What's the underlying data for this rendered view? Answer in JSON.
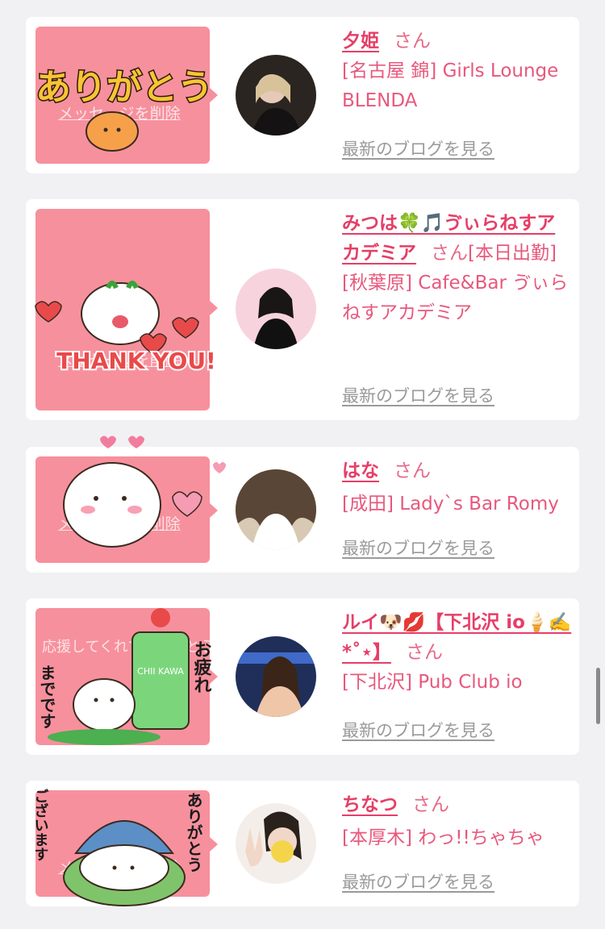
{
  "entries": [
    {
      "name": "夕姫",
      "honorific": "さん",
      "shop": "[名古屋 錦] Girls Lounge BLENDA",
      "blog_link": "最新のブログを見る",
      "sticker_ghost": "メッセージを削除",
      "sticker_text": "ありがとう",
      "sticker_icon": "chick-thanks-sticker",
      "avatar_icon": "avatar-dark-hair"
    },
    {
      "name": "みつは🍀🎵ゔぃらねすアカデミア",
      "honorific": "さん",
      "shop_extra": "[本日出勤]",
      "shop": "[秋葉原] Cafe&Bar ゔぃらねすアカデミア",
      "blog_link": "最新のブログを見る",
      "sticker_ghost": "メッセージを削除",
      "sticker_text": "THANK YOU!",
      "sticker_icon": "bear-thank-you-sticker",
      "avatar_icon": "avatar-black-dress"
    },
    {
      "name": "はな",
      "honorific": "さん",
      "shop": "[成田] Lady`s Bar Romy",
      "blog_link": "最新のブログを見る",
      "sticker_ghost": "メッセージを削除",
      "sticker_icon": "bear-hearts-sticker",
      "avatar_icon": "avatar-brown-hair"
    },
    {
      "name": "ルイ🐶💋【下北沢 io🍦✍️*˚⋆】",
      "honorific": "さん",
      "shop": "[下北沢] Pub Club io",
      "blog_link": "最新のブログを見る",
      "sticker_ghost": "応援してくれてありがとう",
      "sticker_text_right": "お疲れ",
      "sticker_text_left": "までです",
      "sticker_cup_label": "CHII KAWA",
      "sticker_icon": "bear-cream-soda-sticker",
      "avatar_icon": "avatar-night-city"
    },
    {
      "name": "ちなつ",
      "honorific": "さん",
      "shop": "[本厚木] わっ!!ちゃちゃ",
      "blog_link": "最新のブログを見る",
      "sticker_ghost": "メッセージを削除",
      "sticker_text_left": "ございます",
      "sticker_text_right": "ありがとう",
      "sticker_icon": "blue-hat-bow-sticker",
      "avatar_icon": "avatar-peace-sign"
    }
  ],
  "colors": {
    "accent": "#e63e67",
    "sticker_bg": "#f7909d",
    "page_bg": "#f1f1f3",
    "link_gray": "#9a9a9a"
  }
}
